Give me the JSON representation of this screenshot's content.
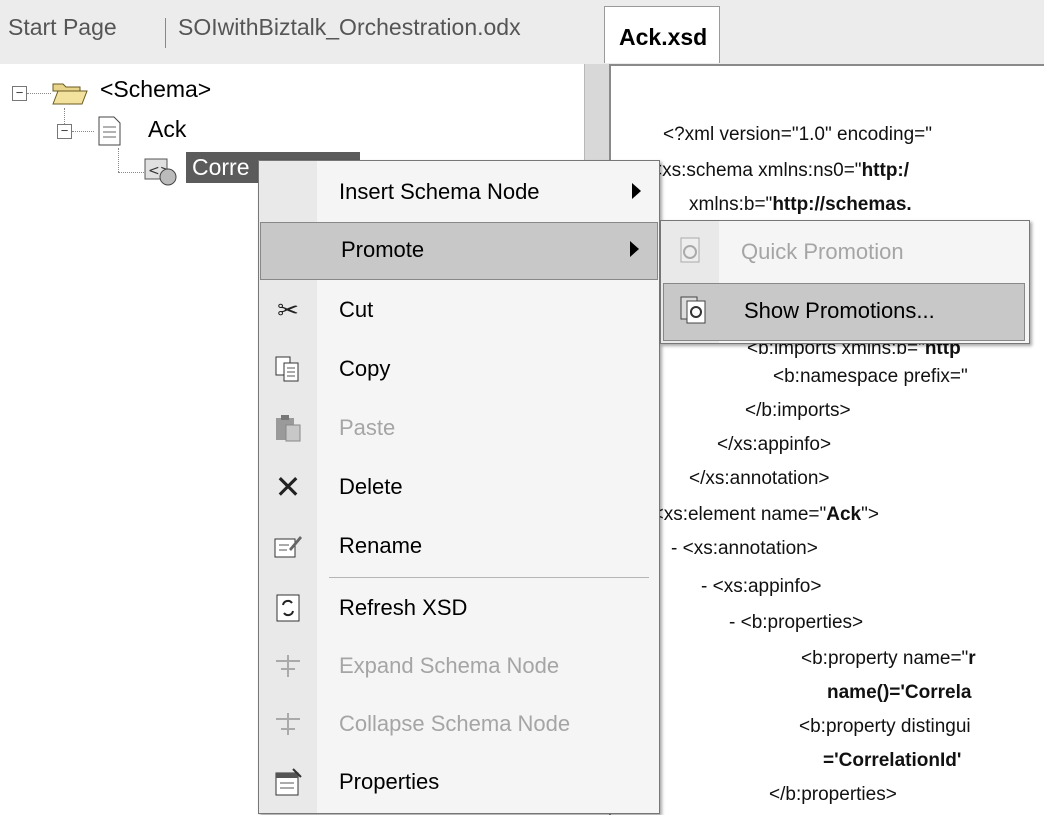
{
  "tabs": [
    {
      "label": "Start Page"
    },
    {
      "label": "SOIwithBiztalk_Orchestration.odx"
    },
    {
      "label": "Ack.xsd",
      "active": true
    }
  ],
  "tree": {
    "root": "<Schema>",
    "child": "Ack",
    "selected": "Corre"
  },
  "xml_lines": [
    {
      "pre": "<?xml version=\"1.0\" encoding=\"",
      "b": "",
      "post": ""
    },
    {
      "pre": "<xs:schema xmlns:ns0=\"",
      "b": "http:/",
      "post": ""
    },
    {
      "pre": "xmlns:b=\"",
      "b": "http://schemas.",
      "post": ""
    },
    {
      "pre": "<b:imports xmlns:b=\"",
      "b": "http",
      "post": ""
    },
    {
      "pre": "<b:namespace prefix=\"",
      "b": "",
      "post": ""
    },
    {
      "pre": "</b:imports>",
      "b": "",
      "post": ""
    },
    {
      "pre": "</xs:appinfo>",
      "b": "",
      "post": ""
    },
    {
      "pre": "</xs:annotation>",
      "b": "",
      "post": ""
    },
    {
      "pre": "- <xs:element name=\"",
      "b": "Ack",
      "post": "\">"
    },
    {
      "pre": "- <xs:annotation>",
      "b": "",
      "post": ""
    },
    {
      "pre": "- <xs:appinfo>",
      "b": "",
      "post": ""
    },
    {
      "pre": "- <b:properties>",
      "b": "",
      "post": ""
    },
    {
      "pre": "<b:property name=\"",
      "b": "r",
      "post": ""
    },
    {
      "pre": "",
      "b": "name()='Correla",
      "post": ""
    },
    {
      "pre": "<b:property distingui",
      "b": "",
      "post": ""
    },
    {
      "pre": "",
      "b": "='CorrelationId'",
      "post": ""
    },
    {
      "pre": "</b:properties>",
      "b": "",
      "post": ""
    }
  ],
  "context_menu": {
    "items": [
      {
        "label": "Insert Schema Node",
        "icon": "none",
        "submenu": true
      },
      {
        "label": "Promote",
        "icon": "none",
        "submenu": true,
        "highlighted": true
      },
      {
        "label": "Cut",
        "icon": "scissors-icon"
      },
      {
        "label": "Copy",
        "icon": "copy-icon"
      },
      {
        "label": "Paste",
        "icon": "paste-icon",
        "disabled": true
      },
      {
        "label": "Delete",
        "icon": "delete-x-icon"
      },
      {
        "label": "Rename",
        "icon": "rename-icon"
      },
      {
        "label": "Refresh XSD",
        "icon": "refresh-icon"
      },
      {
        "label": "Expand Schema Node",
        "icon": "expand-node-icon",
        "disabled": true
      },
      {
        "label": "Collapse Schema Node",
        "icon": "collapse-node-icon",
        "disabled": true
      },
      {
        "label": "Properties",
        "icon": "properties-icon"
      }
    ]
  },
  "submenu": {
    "items": [
      {
        "label": "Quick Promotion",
        "icon": "quick-promotion-icon",
        "disabled": true
      },
      {
        "label": "Show Promotions...",
        "icon": "show-promotions-icon",
        "highlighted": true
      }
    ]
  }
}
